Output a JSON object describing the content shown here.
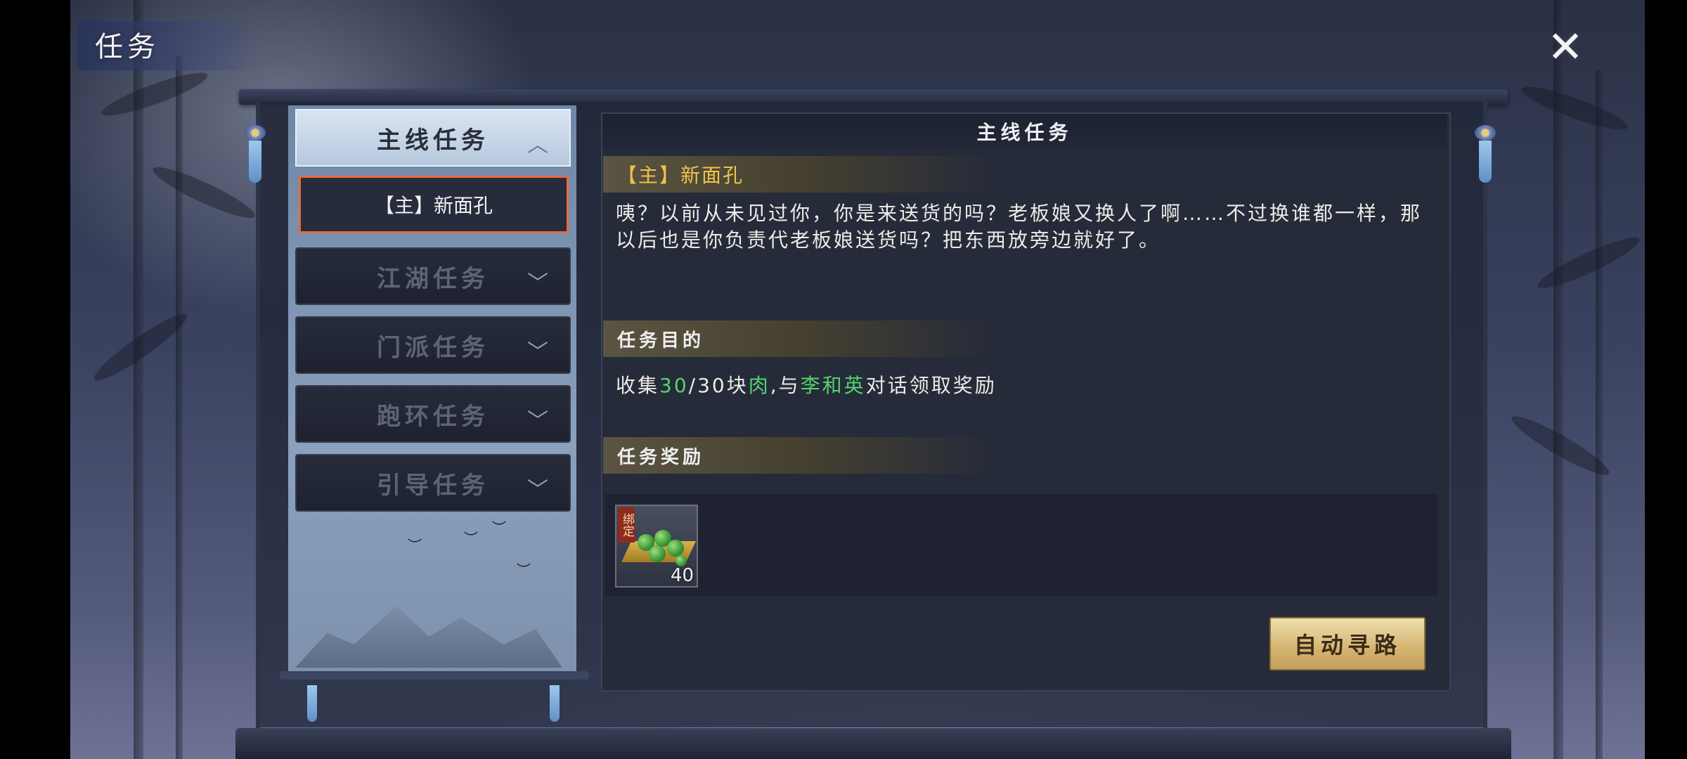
{
  "window": {
    "title": "任务",
    "close_glyph": "✕"
  },
  "categories": [
    {
      "label": "主线任务",
      "expanded": true
    },
    {
      "label": "江湖任务",
      "expanded": false
    },
    {
      "label": "门派任务",
      "expanded": false
    },
    {
      "label": "跑环任务",
      "expanded": false
    },
    {
      "label": "引导任务",
      "expanded": false
    }
  ],
  "selected_quest": {
    "label": "【主】新面孔"
  },
  "detail": {
    "header": "主线任务",
    "quest_title": "【主】新面孔",
    "description": "咦？以前从未见过你，你是来送货的吗？老板娘又换人了啊……不过换谁都一样，那以后也是你负责代老板娘送货吗？把东西放旁边就好了。",
    "objective_heading": "任务目的",
    "objective": {
      "prefix": "收集",
      "current": "30",
      "sep": "/",
      "total": "30",
      "unit": "块",
      "item": "肉",
      "mid": ",与",
      "npc": "李和英",
      "suffix": "对话领取奖励"
    },
    "reward_heading": "任务奖励",
    "rewards": [
      {
        "tag": "绑定",
        "count": "40",
        "icon": "green-pellets-icon"
      }
    ],
    "action_button": "自动寻路"
  },
  "colors": {
    "highlight": "#54d46e",
    "quest_title": "#f0c24a",
    "selected_border": "#e86b3c"
  }
}
